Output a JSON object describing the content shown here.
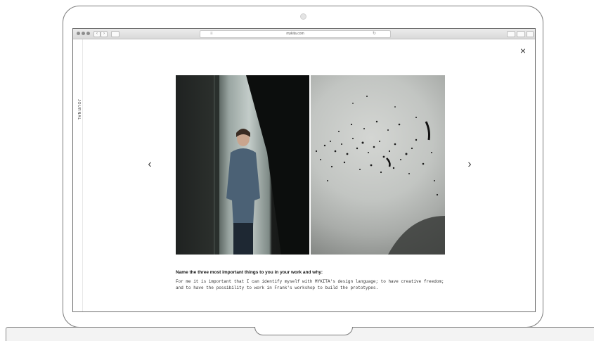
{
  "browser": {
    "url": "mykita.com",
    "back_label": "‹",
    "forward_label": "›"
  },
  "sidebar": {
    "label": "JOURNAL"
  },
  "modal": {
    "close_icon": "×",
    "prev_icon": "‹",
    "next_icon": "›",
    "question": "Name the three most important things to you in your work and why:",
    "answer": "For me it is important that I can identify myself with MYKITA's design language; to have creative freedom; and to have the possibility to work in Frank's workshop to build the prototypes."
  },
  "colors": {
    "frame": "#7a7a7a",
    "screen_bg": "#ffffff",
    "text": "#111111"
  }
}
